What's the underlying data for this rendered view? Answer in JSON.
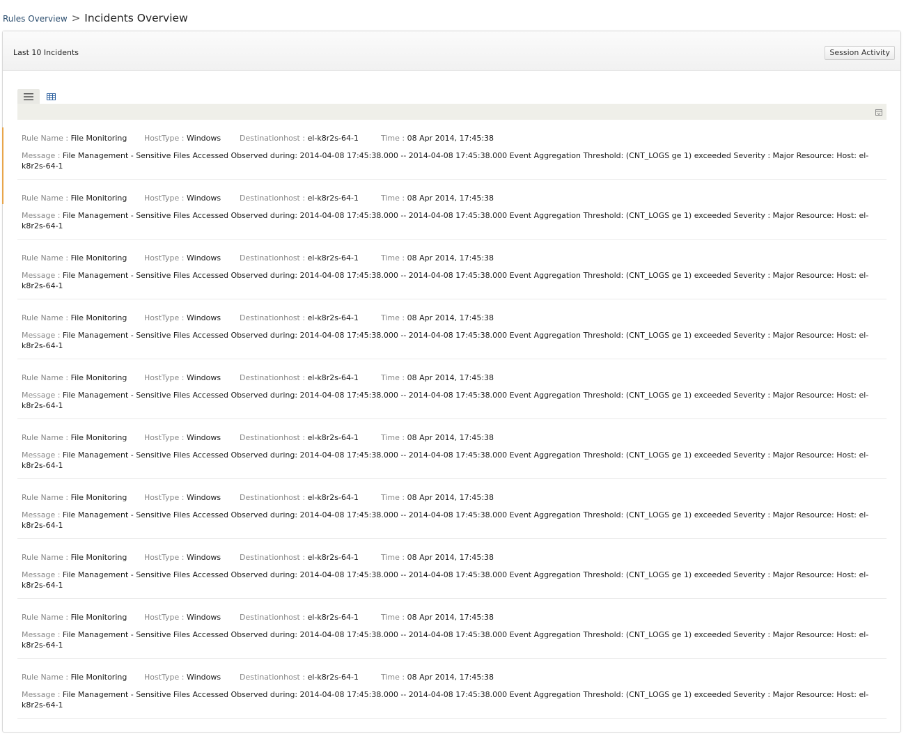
{
  "breadcrumb": {
    "parent": "Rules Overview",
    "separator": ">",
    "current": "Incidents Overview"
  },
  "panel": {
    "title": "Last 10 Incidents",
    "session_button": "Session Activity"
  },
  "view_toggles": {
    "list_icon": "list-view-icon",
    "grid_icon": "grid-view-icon",
    "active": "list"
  },
  "toolbar": {
    "export_icon": "export-icon"
  },
  "field_labels": {
    "rule_name": "Rule Name :",
    "host_type": "HostType :",
    "destination_host": "Destinationhost :",
    "time": "Time :",
    "message": "Message :"
  },
  "incidents": [
    {
      "rule_name": "File Monitoring",
      "host_type": "Windows",
      "destination_host": "el-k8r2s-64-1",
      "time": "08 Apr 2014, 17:45:38",
      "message": "File Management - Sensitive Files Accessed Observed during: 2014-04-08 17:45:38.000 -- 2014-04-08 17:45:38.000 Event Aggregation Threshold: (CNT_LOGS ge 1) exceeded Severity : Major Resource: Host: el-k8r2s-64-1"
    },
    {
      "rule_name": "File Monitoring",
      "host_type": "Windows",
      "destination_host": "el-k8r2s-64-1",
      "time": "08 Apr 2014, 17:45:38",
      "message": "File Management - Sensitive Files Accessed Observed during: 2014-04-08 17:45:38.000 -- 2014-04-08 17:45:38.000 Event Aggregation Threshold: (CNT_LOGS ge 1) exceeded Severity : Major Resource: Host: el-k8r2s-64-1"
    },
    {
      "rule_name": "File Monitoring",
      "host_type": "Windows",
      "destination_host": "el-k8r2s-64-1",
      "time": "08 Apr 2014, 17:45:38",
      "message": "File Management - Sensitive Files Accessed Observed during: 2014-04-08 17:45:38.000 -- 2014-04-08 17:45:38.000 Event Aggregation Threshold: (CNT_LOGS ge 1) exceeded Severity : Major Resource: Host: el-k8r2s-64-1"
    },
    {
      "rule_name": "File Monitoring",
      "host_type": "Windows",
      "destination_host": "el-k8r2s-64-1",
      "time": "08 Apr 2014, 17:45:38",
      "message": "File Management - Sensitive Files Accessed Observed during: 2014-04-08 17:45:38.000 -- 2014-04-08 17:45:38.000 Event Aggregation Threshold: (CNT_LOGS ge 1) exceeded Severity : Major Resource: Host: el-k8r2s-64-1"
    },
    {
      "rule_name": "File Monitoring",
      "host_type": "Windows",
      "destination_host": "el-k8r2s-64-1",
      "time": "08 Apr 2014, 17:45:38",
      "message": "File Management - Sensitive Files Accessed Observed during: 2014-04-08 17:45:38.000 -- 2014-04-08 17:45:38.000 Event Aggregation Threshold: (CNT_LOGS ge 1) exceeded Severity : Major Resource: Host: el-k8r2s-64-1"
    },
    {
      "rule_name": "File Monitoring",
      "host_type": "Windows",
      "destination_host": "el-k8r2s-64-1",
      "time": "08 Apr 2014, 17:45:38",
      "message": "File Management - Sensitive Files Accessed Observed during: 2014-04-08 17:45:38.000 -- 2014-04-08 17:45:38.000 Event Aggregation Threshold: (CNT_LOGS ge 1) exceeded Severity : Major Resource: Host: el-k8r2s-64-1"
    },
    {
      "rule_name": "File Monitoring",
      "host_type": "Windows",
      "destination_host": "el-k8r2s-64-1",
      "time": "08 Apr 2014, 17:45:38",
      "message": "File Management - Sensitive Files Accessed Observed during: 2014-04-08 17:45:38.000 -- 2014-04-08 17:45:38.000 Event Aggregation Threshold: (CNT_LOGS ge 1) exceeded Severity : Major Resource: Host: el-k8r2s-64-1"
    },
    {
      "rule_name": "File Monitoring",
      "host_type": "Windows",
      "destination_host": "el-k8r2s-64-1",
      "time": "08 Apr 2014, 17:45:38",
      "message": "File Management - Sensitive Files Accessed Observed during: 2014-04-08 17:45:38.000 -- 2014-04-08 17:45:38.000 Event Aggregation Threshold: (CNT_LOGS ge 1) exceeded Severity : Major Resource: Host: el-k8r2s-64-1"
    },
    {
      "rule_name": "File Monitoring",
      "host_type": "Windows",
      "destination_host": "el-k8r2s-64-1",
      "time": "08 Apr 2014, 17:45:38",
      "message": "File Management - Sensitive Files Accessed Observed during: 2014-04-08 17:45:38.000 -- 2014-04-08 17:45:38.000 Event Aggregation Threshold: (CNT_LOGS ge 1) exceeded Severity : Major Resource: Host: el-k8r2s-64-1"
    },
    {
      "rule_name": "File Monitoring",
      "host_type": "Windows",
      "destination_host": "el-k8r2s-64-1",
      "time": "08 Apr 2014, 17:45:38",
      "message": "File Management - Sensitive Files Accessed Observed during: 2014-04-08 17:45:38.000 -- 2014-04-08 17:45:38.000 Event Aggregation Threshold: (CNT_LOGS ge 1) exceeded Severity : Major Resource: Host: el-k8r2s-64-1"
    }
  ]
}
